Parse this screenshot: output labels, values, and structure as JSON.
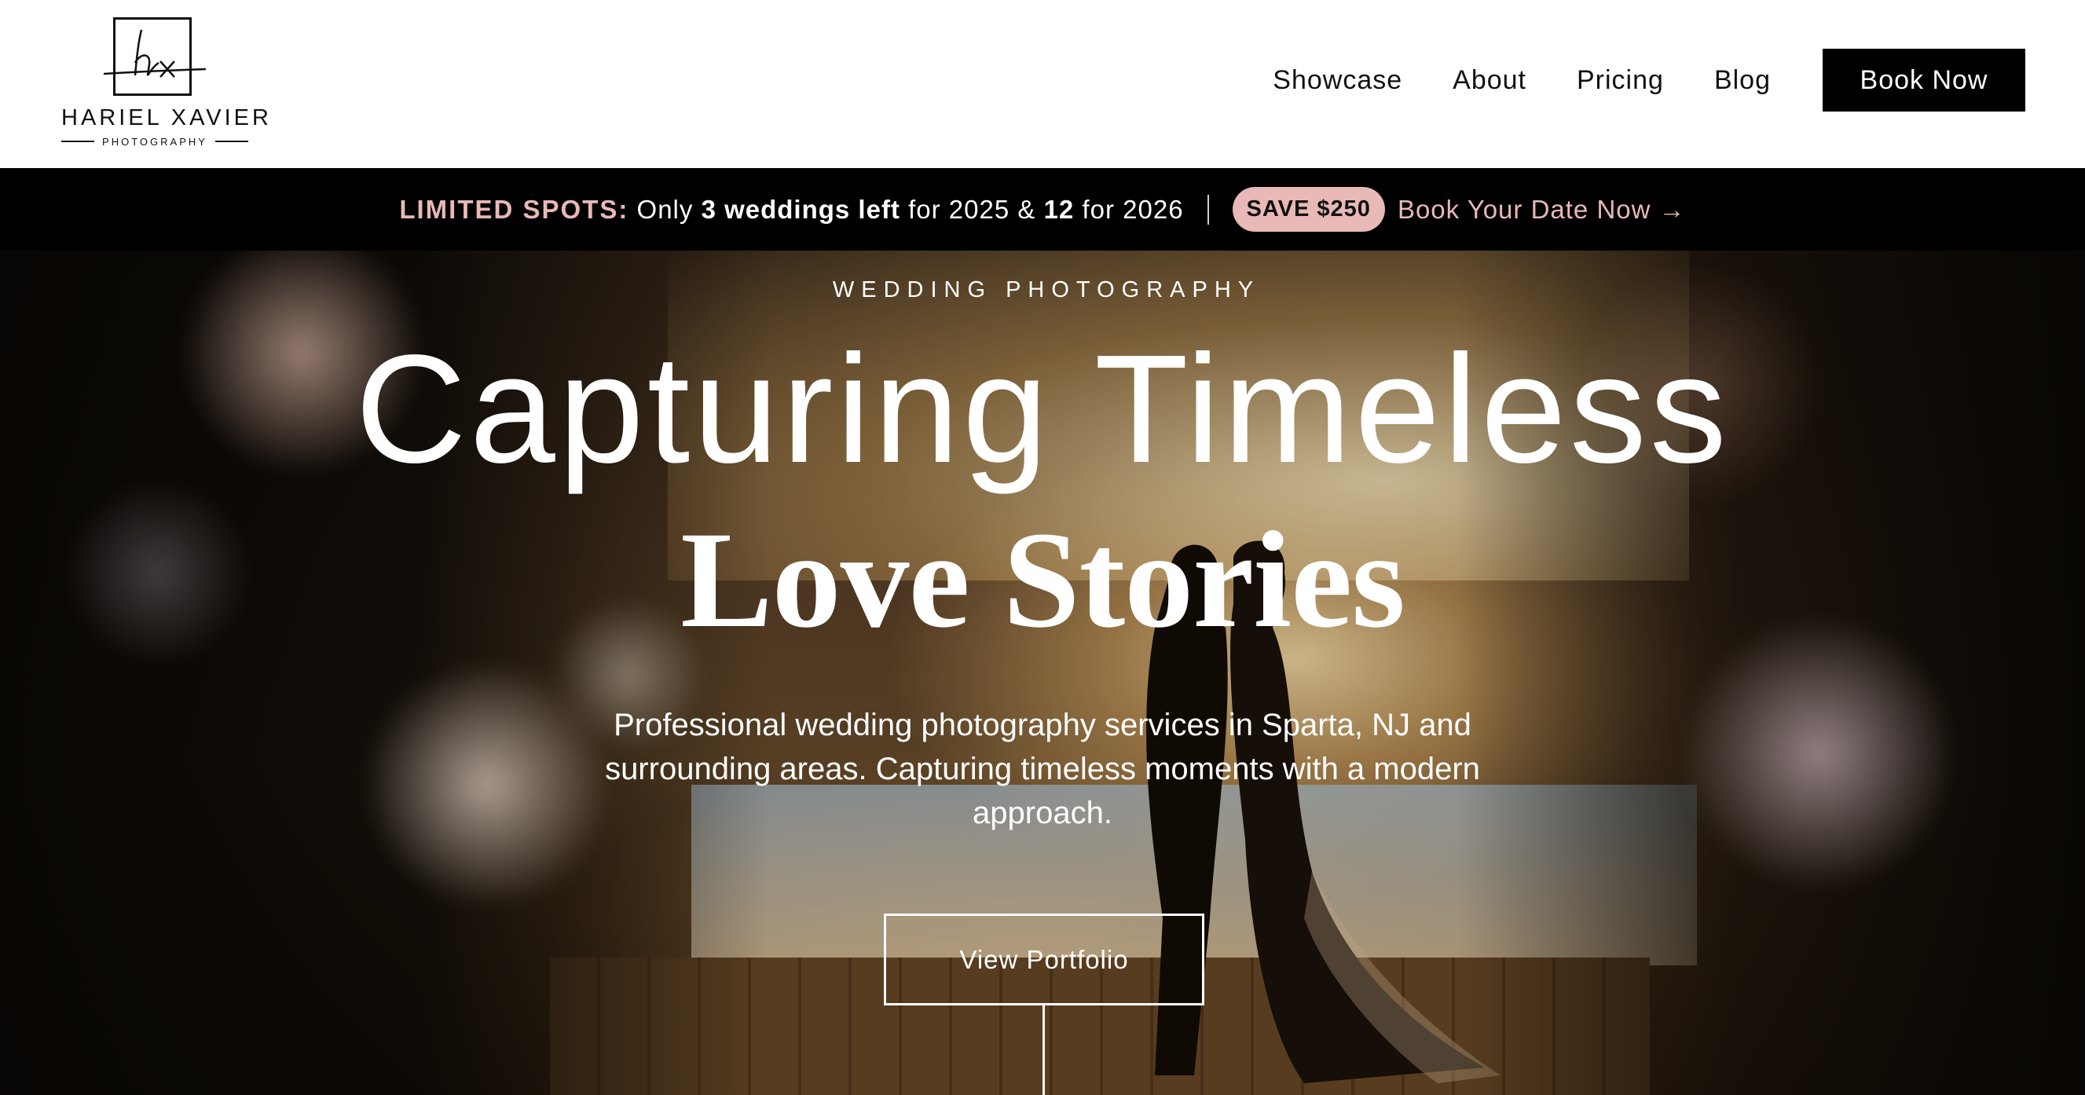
{
  "brand": {
    "name": "HARIEL XAVIER",
    "sub": "PHOTOGRAPHY",
    "monogram": "hx"
  },
  "nav": {
    "items": [
      "Showcase",
      "About",
      "Pricing",
      "Blog"
    ],
    "cta": "Book Now"
  },
  "promo": {
    "label": "LIMITED SPOTS:",
    "text_only": "Only",
    "count_2025": "3 weddings left",
    "text_for_2025": "for 2025 &",
    "count_2026": "12",
    "text_for_2026": "for 2026",
    "badge": "SAVE $250",
    "cta": "Book Your Date Now →"
  },
  "hero": {
    "eyebrow": "WEDDING PHOTOGRAPHY",
    "title_line1": "Capturing Timeless",
    "title_line2": "Love Stories",
    "description": "Professional wedding photography services in Sparta, NJ and surrounding areas. Capturing timeless moments with a modern approach.",
    "button": "View Portfolio"
  },
  "colors": {
    "accent_pink": "#e8b9b6",
    "header_bg": "#ffffff",
    "promo_bg": "#000000"
  }
}
